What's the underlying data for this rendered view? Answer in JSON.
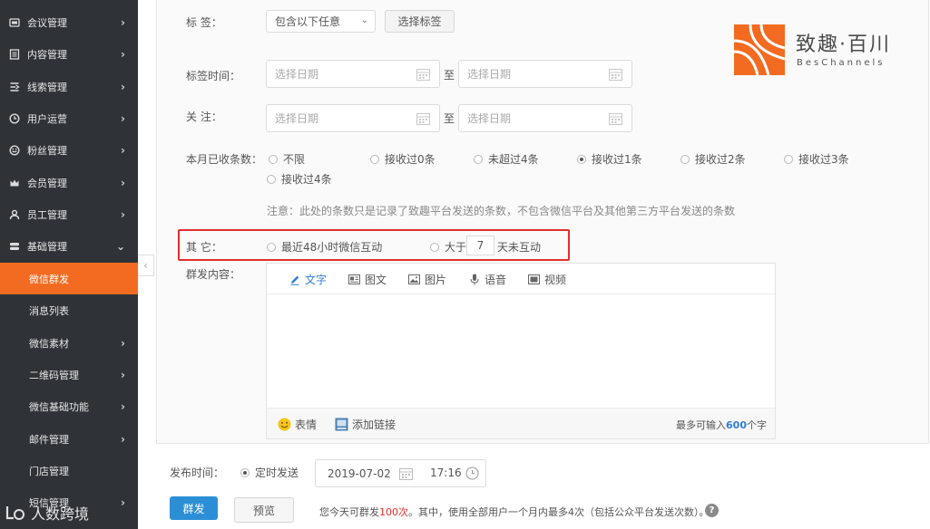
{
  "sidebar": {
    "items": [
      {
        "label": "会议管理",
        "icon": "meeting-icon",
        "chevron": "›"
      },
      {
        "label": "内容管理",
        "icon": "document-icon",
        "chevron": "›"
      },
      {
        "label": "线索管理",
        "icon": "funnel-icon",
        "chevron": "›"
      },
      {
        "label": "用户运营",
        "icon": "clock-icon",
        "chevron": "›"
      },
      {
        "label": "粉丝管理",
        "icon": "fan-icon",
        "chevron": "›"
      },
      {
        "label": "会员管理",
        "icon": "crown-icon",
        "chevron": "›"
      },
      {
        "label": "员工管理",
        "icon": "user-icon",
        "chevron": "›"
      },
      {
        "label": "基础管理",
        "icon": "settings-icon",
        "chevron": "⌄"
      }
    ],
    "sub_items": [
      {
        "label": "微信群发",
        "chevron": ""
      },
      {
        "label": "消息列表",
        "chevron": ""
      },
      {
        "label": "微信素材",
        "chevron": "›"
      },
      {
        "label": "二维码管理",
        "chevron": "›"
      },
      {
        "label": "微信基础功能",
        "chevron": "›"
      },
      {
        "label": "邮件管理",
        "chevron": "›"
      },
      {
        "label": "门店管理",
        "chevron": ""
      },
      {
        "label": "短信管理",
        "chevron": "›"
      }
    ],
    "active_item": "微信群发",
    "collapse_glyph": "‹"
  },
  "form": {
    "tags_label": "标  签：",
    "tags_select": "包含以下任意",
    "tags_select_caret": "⌄",
    "select_tags_button": "选择标签",
    "tag_time_label": "标签时间：",
    "follow_label": "关  注：",
    "date_placeholder": "选择日期",
    "range_separator": "至",
    "received_label": "本月已收条数：",
    "received_options": [
      "不限",
      "接收过0条",
      "未超过4条",
      "接收过1条",
      "接收过2条",
      "接收过3条",
      "接收过4条"
    ],
    "received_selected": "接收过1条",
    "received_note": "注意：此处的条数只是记录了致趣平台发送的条数，不包含微信平台及其他第三方平台发送的条数",
    "other_label": "其  它：",
    "interact_48h": "最近48小时微信互动",
    "more_than": "大于",
    "days_value": "7",
    "days_no_interact": "天未互动",
    "content_label": "群发内容："
  },
  "editor": {
    "tabs": [
      {
        "label": "文字",
        "icon": "pencil-icon"
      },
      {
        "label": "图文",
        "icon": "news-icon"
      },
      {
        "label": "图片",
        "icon": "image-icon"
      },
      {
        "label": "语音",
        "icon": "microphone-icon"
      },
      {
        "label": "视频",
        "icon": "video-icon"
      }
    ],
    "active_tab": "文字",
    "emoji_label": "表情",
    "link_label": "添加链接",
    "limit_prefix": "最多可输入",
    "limit_count": "600",
    "limit_suffix": "个字"
  },
  "publish": {
    "time_label": "发布时间：",
    "scheduled_label": "定时发送",
    "date": "2019-07-02",
    "time": "17:16",
    "send_button": "群发",
    "preview_button": "预览",
    "daily_prefix": "您今天可群发",
    "daily_count": "100次",
    "daily_suffix": "。其中，使用全部用户一个月内最多4次（包括公众平台发送次数）。",
    "help_glyph": "?"
  },
  "brand": {
    "name": "致趣·百川",
    "subtitle": "BesChannels",
    "color": "#f26b20"
  },
  "watermark": {
    "text": "人数跨境"
  },
  "colors": {
    "sidebar_bg": "#2f3338",
    "accent": "#f26b20",
    "primary": "#2c8fd6",
    "highlight_box": "#e0302a",
    "link": "#2f7ed8"
  }
}
